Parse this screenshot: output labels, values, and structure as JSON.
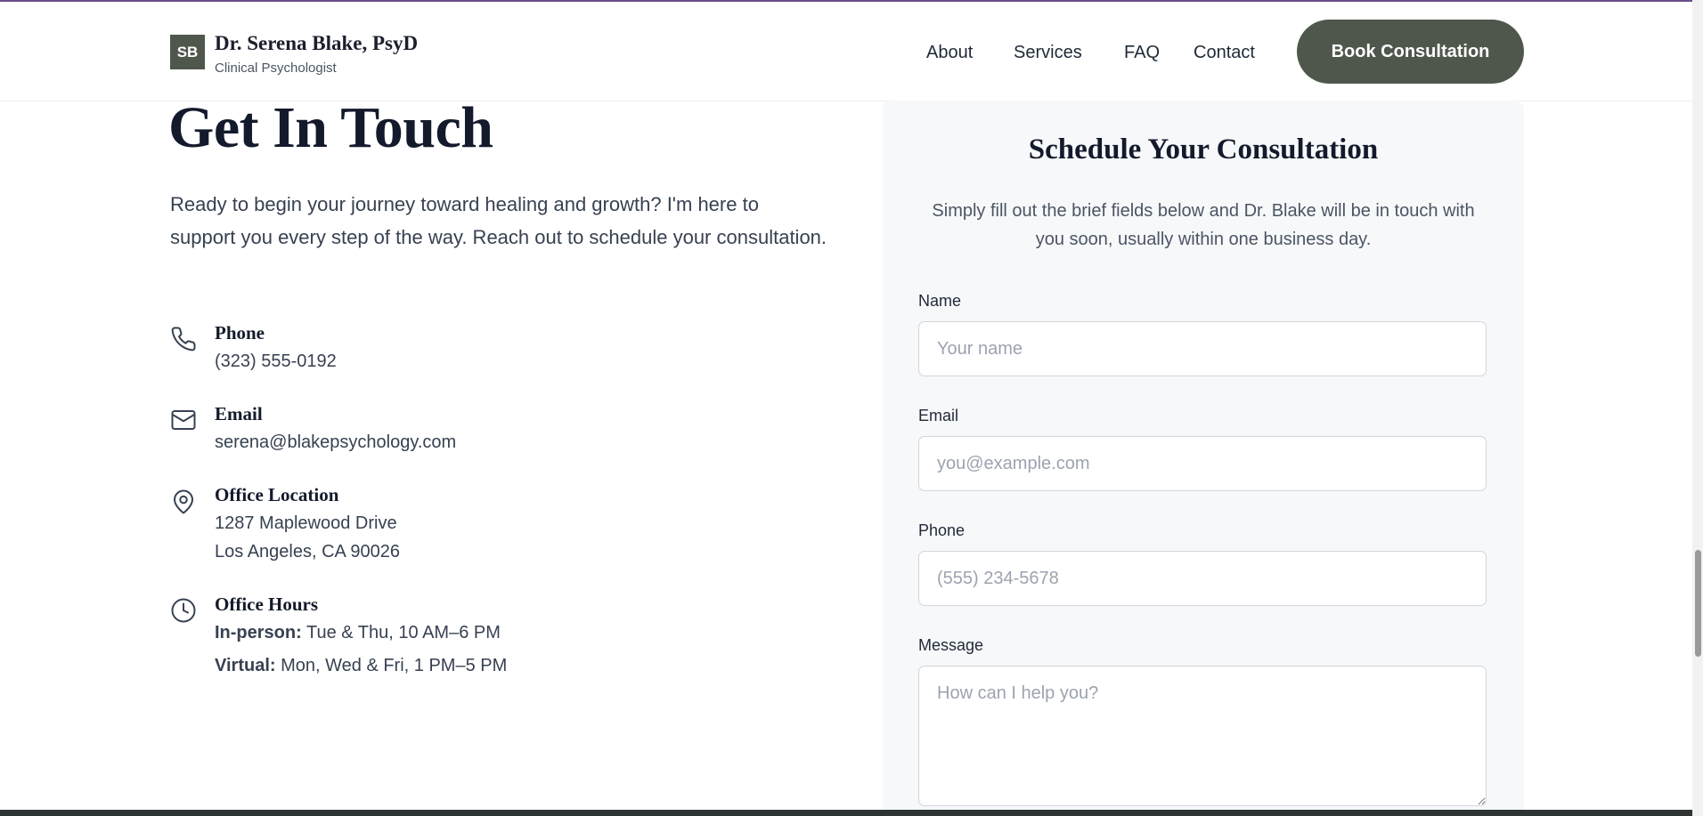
{
  "header": {
    "logo_initials": "SB",
    "name": "Dr. Serena Blake, PsyD",
    "subtitle": "Clinical Psychologist",
    "nav": [
      "About",
      "Services",
      "FAQ",
      "Contact"
    ],
    "cta_label": "Book Consultation"
  },
  "contact": {
    "title": "Get In Touch",
    "intro": "Ready to begin your journey toward healing and growth? I'm here to support you every step of the way. Reach out to schedule your consultation.",
    "phone": {
      "icon": "phone-icon",
      "label": "Phone",
      "value": "(323) 555-0192"
    },
    "email": {
      "icon": "mail-icon",
      "label": "Email",
      "value": "serena@blakepsychology.com"
    },
    "location": {
      "icon": "map-pin-icon",
      "label": "Office Location",
      "line1": "1287 Maplewood Drive",
      "line2": "Los Angeles, CA 90026"
    },
    "hours": {
      "icon": "clock-icon",
      "label": "Office Hours",
      "in_person_label": "In-person:",
      "in_person_value": "Tue & Thu, 10 AM–6 PM",
      "virtual_label": "Virtual:",
      "virtual_value": "Mon, Wed & Fri, 1 PM–5 PM"
    }
  },
  "form": {
    "title": "Schedule Your Consultation",
    "description": "Simply fill out the brief fields below and Dr. Blake will be in touch with you soon, usually within one business day.",
    "name_label": "Name",
    "name_placeholder": "Your name",
    "email_label": "Email",
    "email_placeholder": "you@example.com",
    "phone_label": "Phone",
    "phone_placeholder": "(555) 234-5678",
    "message_label": "Message",
    "message_placeholder": "How can I help you?"
  },
  "colors": {
    "accent": "#4f574d",
    "heading": "#131a2b",
    "panel_bg": "#f7f8fa"
  }
}
